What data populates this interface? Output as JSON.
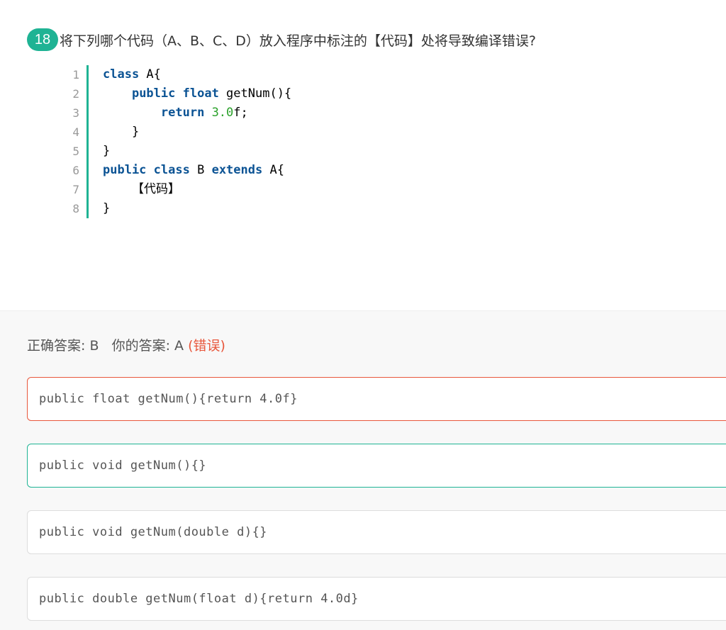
{
  "question": {
    "number": "18",
    "text": "将下列哪个代码（A、B、C、D）放入程序中标注的【代码】处将导致编译错误?"
  },
  "code": {
    "line_numbers": [
      "1",
      "2",
      "3",
      "4",
      "5",
      "6",
      "7",
      "8"
    ],
    "line1": {
      "kw": "class",
      "rest": " A{"
    },
    "line2": {
      "indent": "    ",
      "kw1": "public",
      "sp": " ",
      "kw2": "float",
      "rest": " getNum(){"
    },
    "line3": {
      "indent": "        ",
      "kw": "return",
      "sp": " ",
      "num": "3.0",
      "rest": "f;"
    },
    "line4": {
      "text": "    }"
    },
    "line5": {
      "text": "}"
    },
    "line6": {
      "kw1": "public",
      "sp1": " ",
      "kw2": "class",
      "mid": " B ",
      "kw3": "extends",
      "rest": " A{"
    },
    "line7": {
      "text": "    【代码】"
    },
    "line8": {
      "text": "}"
    }
  },
  "answer": {
    "correct_label": "正确答案: B",
    "yours_label": "你的答案: A",
    "status": "(错误)"
  },
  "options": [
    "public float getNum(){return 4.0f}",
    "public void getNum(){}",
    "public void getNum(double d){}",
    "public double getNum(float d){return 4.0d}"
  ],
  "colors": {
    "accent": "#1fb394",
    "wrong": "#e8573c"
  }
}
